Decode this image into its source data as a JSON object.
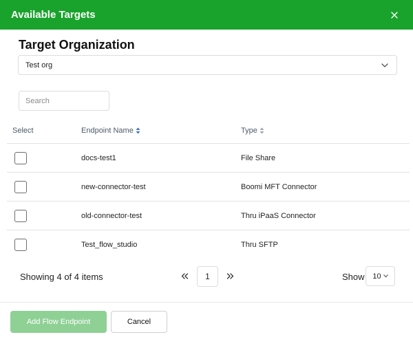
{
  "dialog": {
    "title": "Available Targets"
  },
  "organization": {
    "heading": "Target Organization",
    "selected": "Test org"
  },
  "search": {
    "placeholder": "Search"
  },
  "table": {
    "columns": {
      "select": "Select",
      "name": "Endpoint Name",
      "type": "Type"
    },
    "rows": [
      {
        "name": "docs-test1",
        "type": "File Share"
      },
      {
        "name": "new-connector-test",
        "type": "Boomi MFT Connector"
      },
      {
        "name": "old-connector-test",
        "type": "Thru iPaaS Connector"
      },
      {
        "name": "Test_flow_studio",
        "type": "Thru SFTP"
      }
    ]
  },
  "pagination": {
    "summary": "Showing 4 of 4 items",
    "current_page": "1",
    "show_label": "Show",
    "page_size": "10"
  },
  "actions": {
    "primary": "Add Flow Endpoint",
    "cancel": "Cancel"
  },
  "colors": {
    "header": "#1aa32c",
    "primary_disabled": "#8fd095",
    "sort_active": "#3b6fd6"
  },
  "icons": {
    "close": "close-icon",
    "dropdown": "chevron-down-icon",
    "sort": "sort-icon",
    "prev": "double-chevron-left-icon",
    "next": "double-chevron-right-icon"
  }
}
